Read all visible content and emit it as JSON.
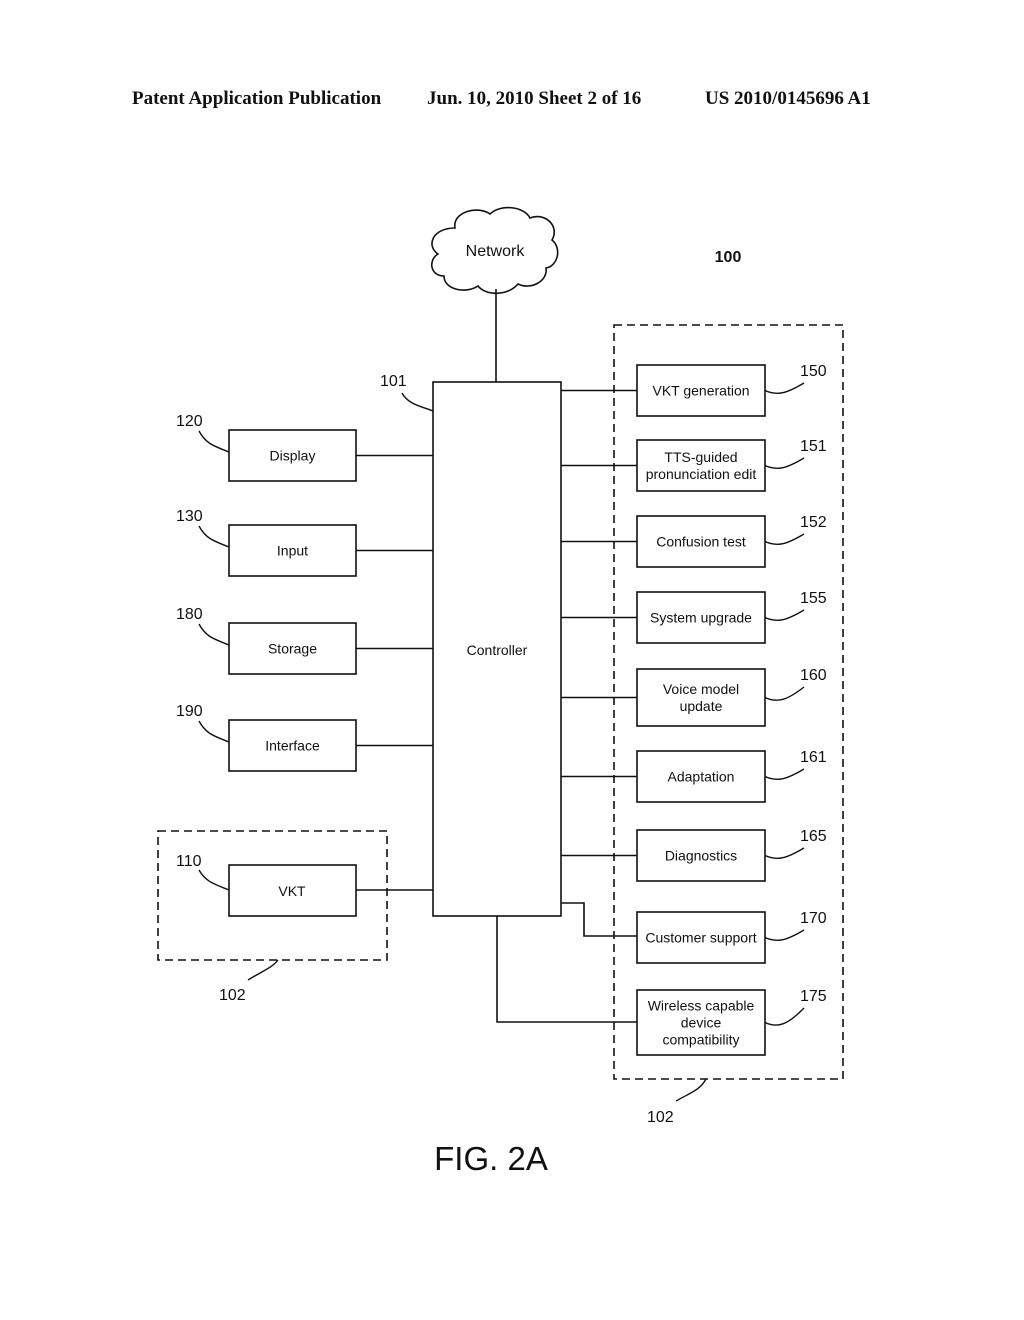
{
  "header": {
    "publication": "Patent Application Publication",
    "date_sheet": "Jun. 10, 2010  Sheet 2 of 16",
    "number": "US 2010/0145696 A1"
  },
  "figure": {
    "label": "FIG. 2A",
    "system_ref": "100",
    "network": {
      "label": "Network"
    },
    "controller": {
      "label": "Controller",
      "ref": "101"
    },
    "left_blocks": [
      {
        "label": "Display",
        "ref": "120"
      },
      {
        "label": "Input",
        "ref": "130"
      },
      {
        "label": "Storage",
        "ref": "180"
      },
      {
        "label": "Interface",
        "ref": "190"
      }
    ],
    "vkt_group": {
      "ref": "102",
      "block": {
        "label": "VKT",
        "ref": "110"
      }
    },
    "right_group": {
      "ref": "102",
      "blocks": [
        {
          "lines": [
            "VKT generation"
          ],
          "ref": "150"
        },
        {
          "lines": [
            "TTS-guided",
            "pronunciation edit"
          ],
          "ref": "151"
        },
        {
          "lines": [
            "Confusion test"
          ],
          "ref": "152"
        },
        {
          "lines": [
            "System upgrade"
          ],
          "ref": "155"
        },
        {
          "lines": [
            "Voice model",
            "update"
          ],
          "ref": "160"
        },
        {
          "lines": [
            "Adaptation"
          ],
          "ref": "161"
        },
        {
          "lines": [
            "Diagnostics"
          ],
          "ref": "165"
        },
        {
          "lines": [
            "Customer support"
          ],
          "ref": "170"
        },
        {
          "lines": [
            "Wireless capable",
            "device",
            "compatibility"
          ],
          "ref": "175"
        }
      ]
    }
  }
}
